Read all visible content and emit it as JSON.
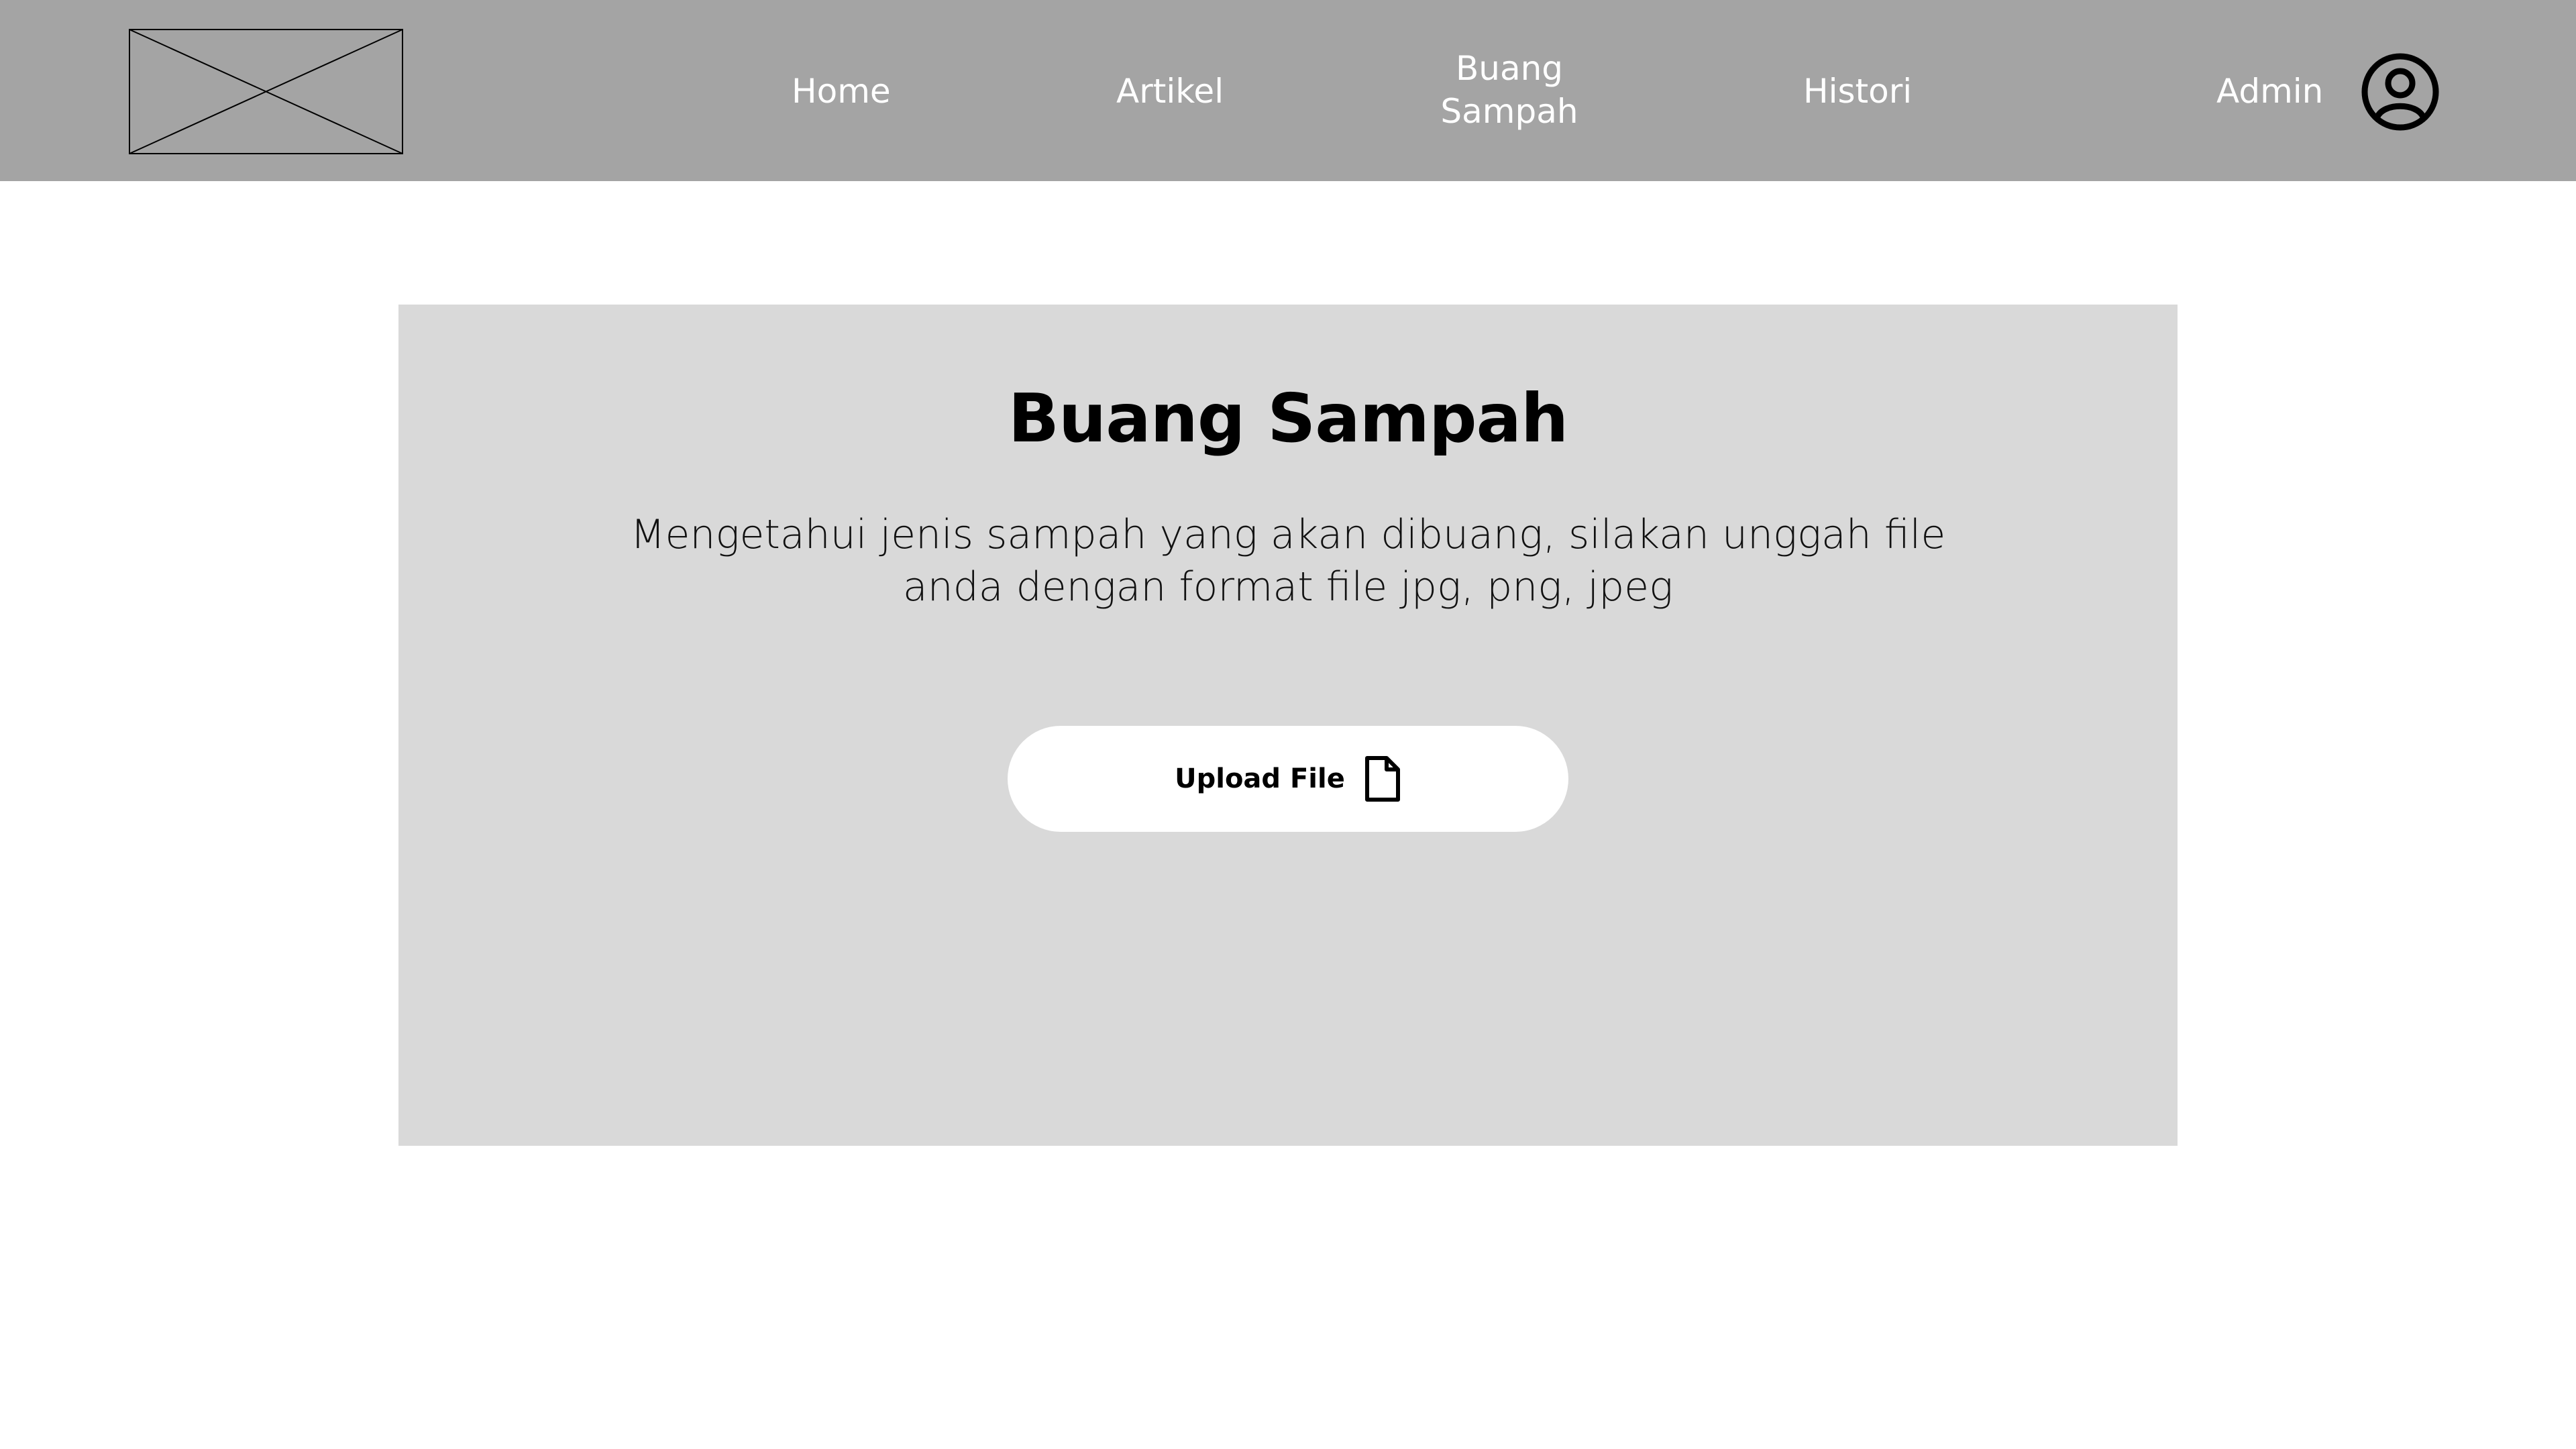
{
  "navbar": {
    "logo_icon": "image-placeholder-icon",
    "items": [
      {
        "label": "Home"
      },
      {
        "label": "Artikel"
      },
      {
        "label": "Buang Sampah"
      },
      {
        "label": "Histori"
      }
    ],
    "admin_label": "Admin",
    "avatar_icon": "user-circle-icon",
    "background_color": "#a4a4a4",
    "text_color": "#ffffff"
  },
  "main": {
    "title": "Buang Sampah",
    "description": "Mengetahui jenis sampah yang akan dibuang, silakan unggah file anda dengan format file jpg, png, jpeg",
    "upload_button": {
      "label": "Upload File",
      "icon": "file-icon"
    },
    "card_color": "#d9d9d9"
  }
}
